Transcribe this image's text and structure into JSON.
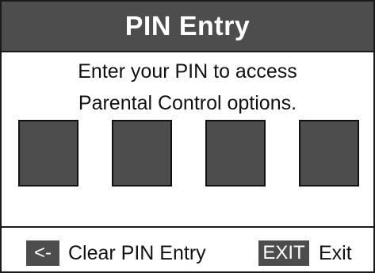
{
  "dialog": {
    "title": "PIN Entry",
    "prompt_line1": "Enter your PIN to access",
    "prompt_line2": "Parental Control options.",
    "pin_digits": [
      "",
      "",
      "",
      ""
    ]
  },
  "footer": {
    "clear_key": "<-",
    "clear_label": "Clear PIN Entry",
    "exit_key": "EXIT",
    "exit_label": "Exit"
  },
  "colors": {
    "title_bg": "#4d4d4d",
    "box_fill": "#4d4d4d",
    "border": "#1a1a1a",
    "background": "#ffffff"
  }
}
